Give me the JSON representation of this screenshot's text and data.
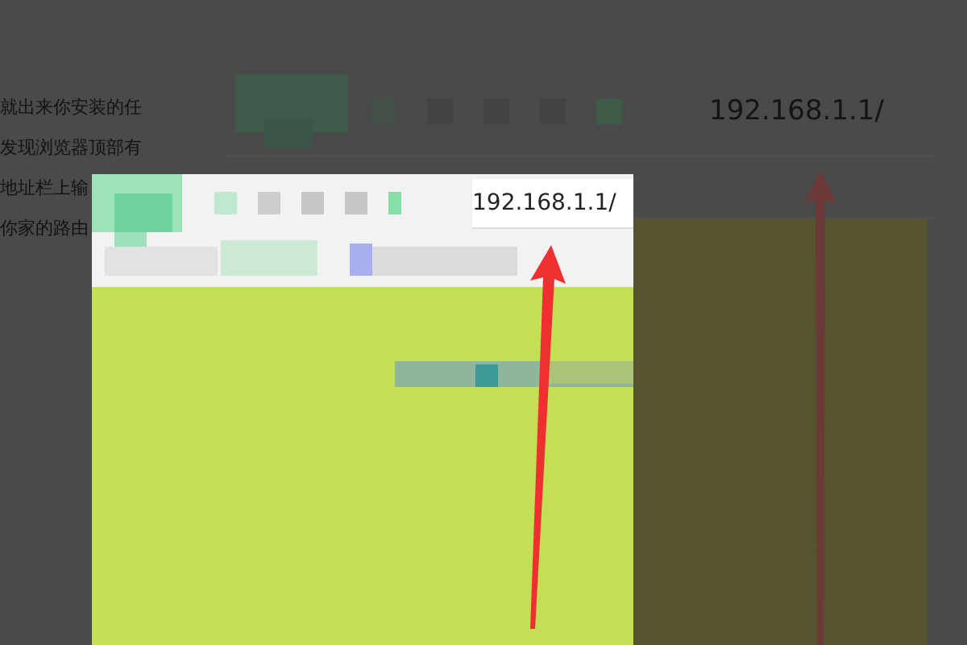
{
  "background_page": {
    "article_lines": [
      "就出来你安装的任",
      "发现浏览器顶部有",
      "地址栏上输",
      "你家的路由"
    ],
    "address_bar": {
      "value": "192.168.1.1/"
    }
  },
  "popup": {
    "address_bar": {
      "value": "192.168.1.1/"
    }
  }
}
